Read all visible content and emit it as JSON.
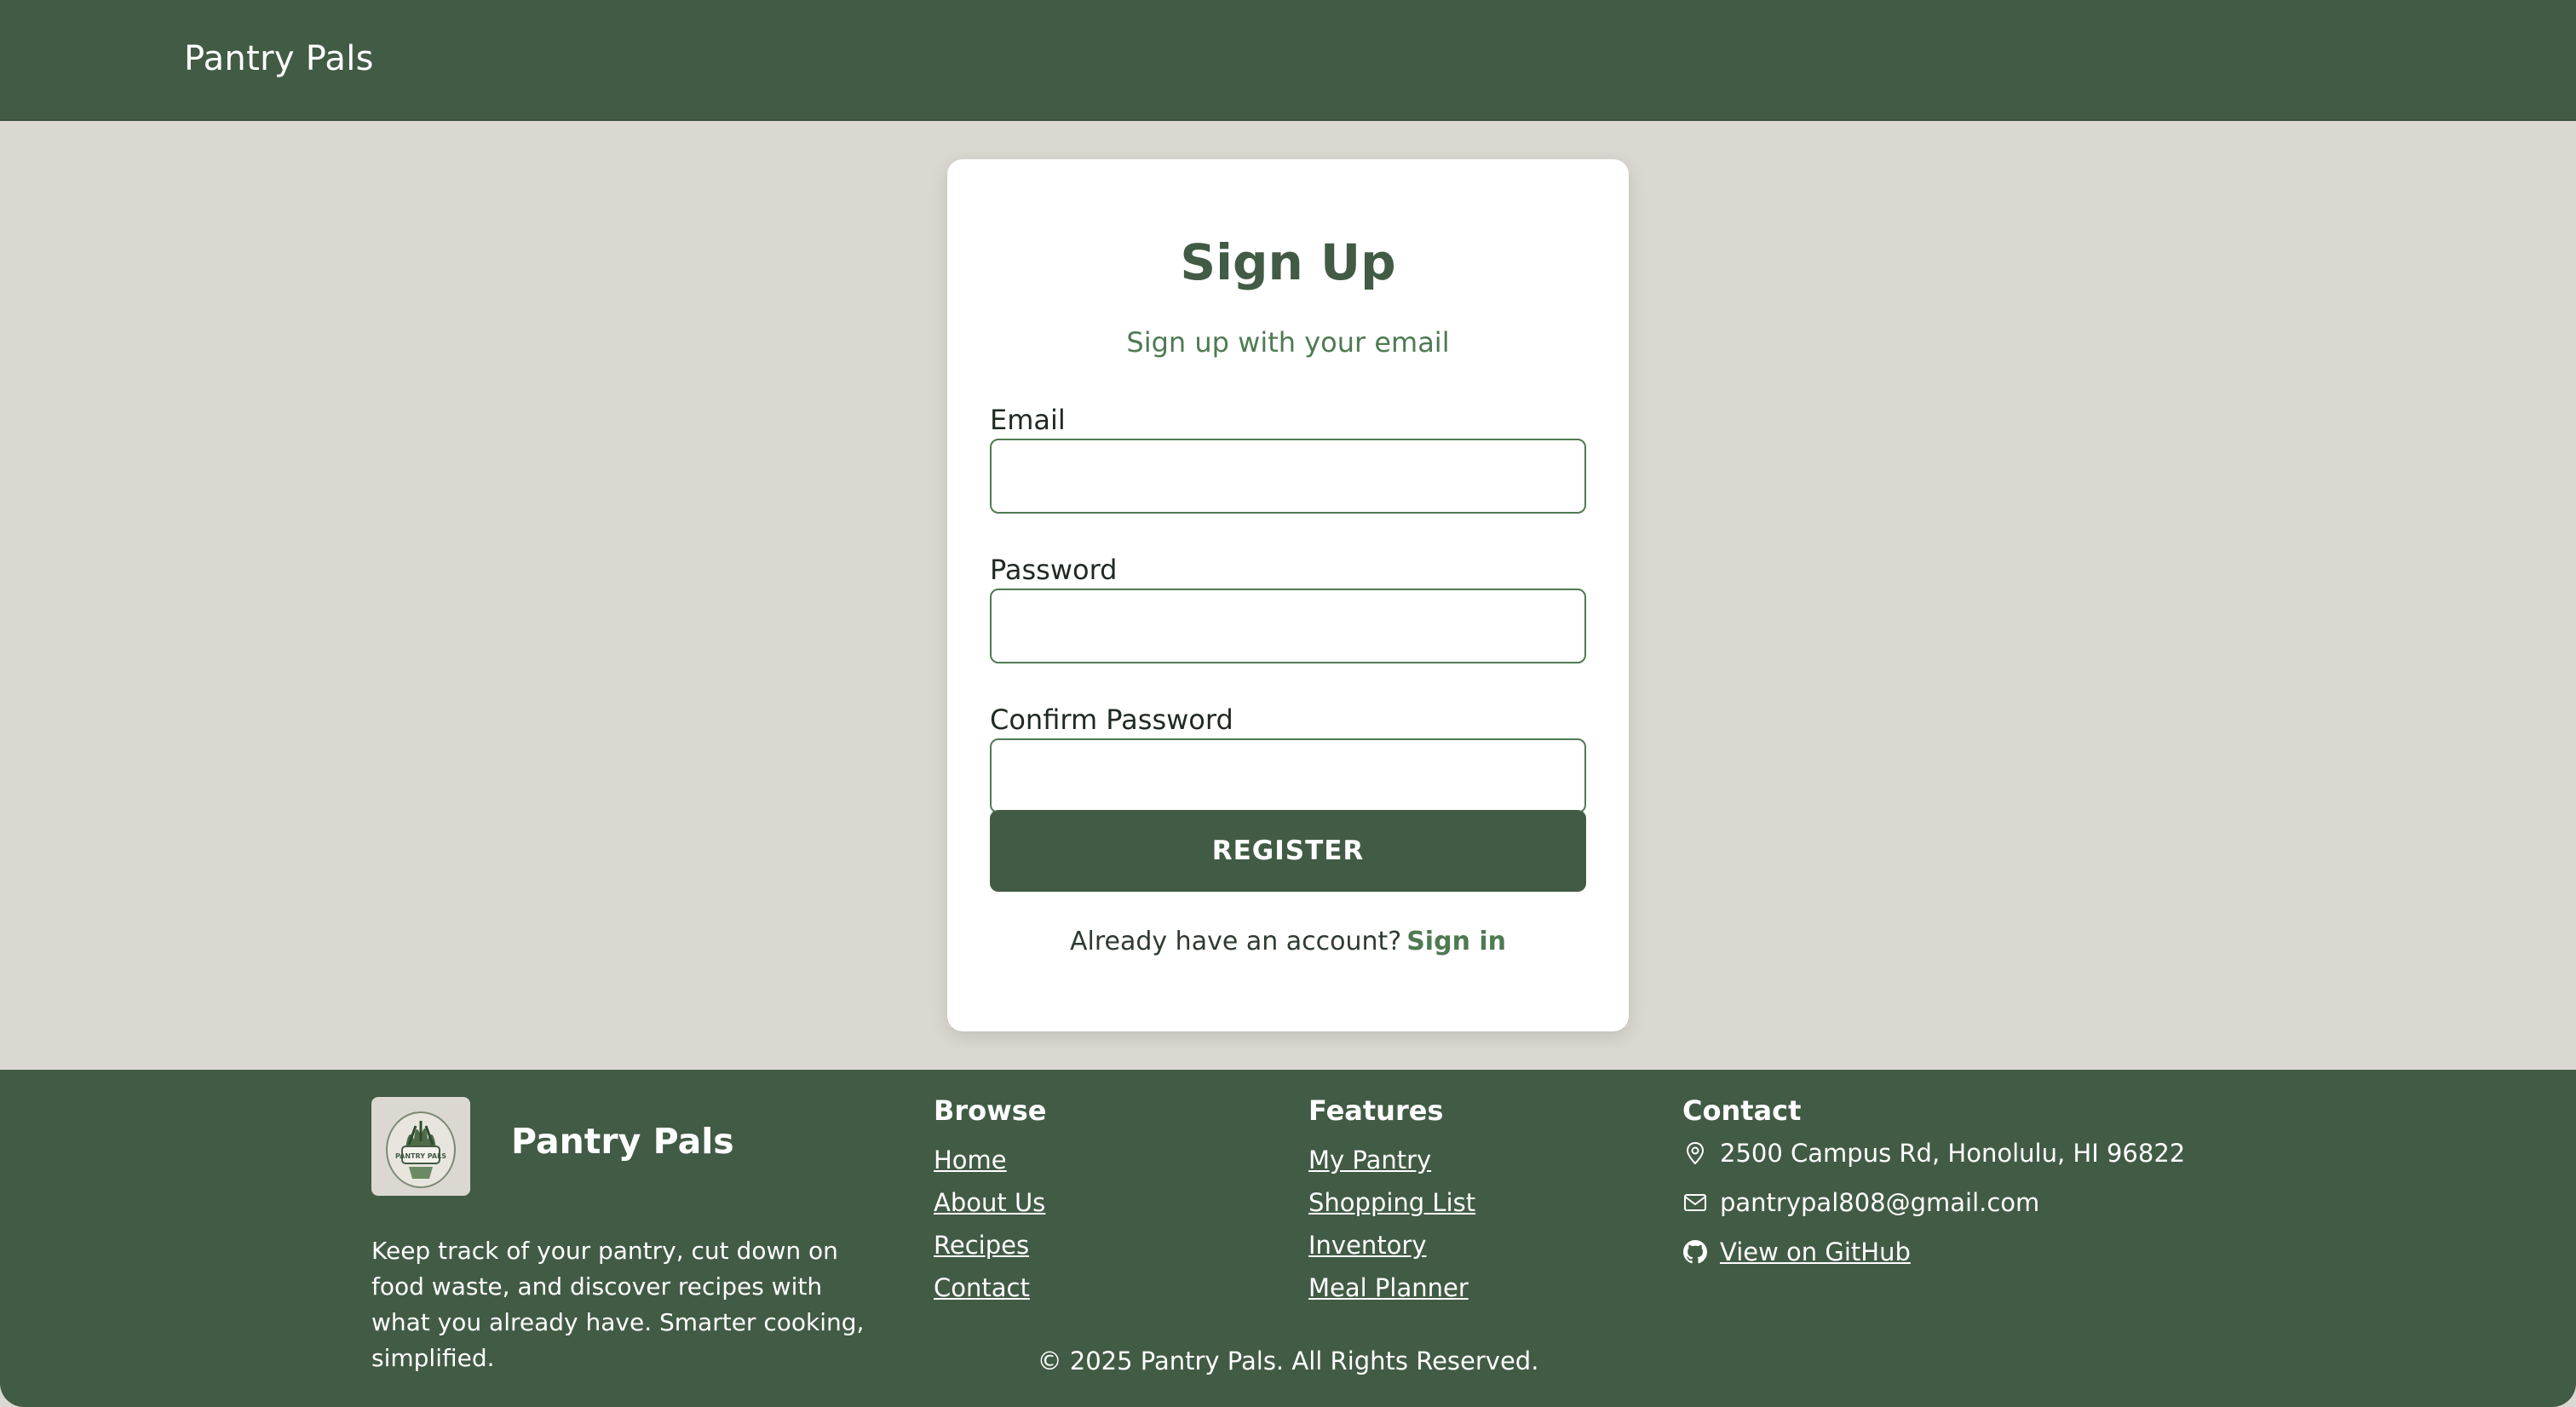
{
  "navbar": {
    "brand": "Pantry Pals"
  },
  "signup": {
    "title": "Sign Up",
    "subtitle": "Sign up with your email",
    "fields": [
      {
        "label": "Email",
        "value": "",
        "placeholder": ""
      },
      {
        "label": "Password",
        "value": "",
        "placeholder": ""
      },
      {
        "label": "Confirm Password",
        "value": "",
        "placeholder": ""
      }
    ],
    "register_label": "REGISTER",
    "account_prompt": "Already have an account?",
    "signin_label": "Sign in"
  },
  "footer": {
    "brand": "Pantry Pals",
    "logo_text": "PANTRY PALS",
    "description": "Keep track of your pantry, cut down on food waste, and discover recipes with what you already have. Smarter cooking, simplified.",
    "browse": {
      "title": "Browse",
      "links": [
        "Home",
        "About Us",
        "Recipes",
        "Contact"
      ]
    },
    "features": {
      "title": "Features",
      "links": [
        "My Pantry",
        "Shopping List",
        "Inventory",
        "Meal Planner"
      ]
    },
    "contact": {
      "title": "Contact",
      "address": "2500 Campus Rd, Honolulu, HI 96822",
      "email": "pantrypal808@gmail.com",
      "github": "View on GitHub",
      "icons": [
        "map-pin-icon",
        "envelope-icon",
        "github-icon"
      ]
    },
    "copyright": "© 2025 Pantry Pals. All Rights Reserved."
  },
  "colors": {
    "primary": "#425b45",
    "accent": "#4f7a52",
    "background": "#dbd8d1",
    "card": "#ffffff"
  }
}
